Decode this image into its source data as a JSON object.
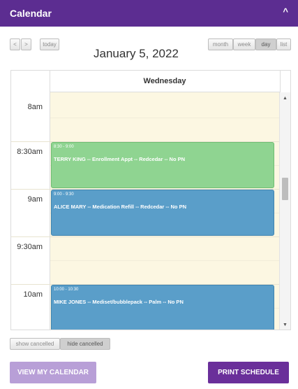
{
  "header": {
    "title": "Calendar",
    "collapse_icon": "chevron-up-icon"
  },
  "toolbar": {
    "prev_label": "<",
    "next_label": ">",
    "today_label": "today",
    "views": [
      "month",
      "week",
      "day",
      "list"
    ],
    "active_view": "day"
  },
  "calendar": {
    "title": "January 5, 2022",
    "day_header": "Wednesday",
    "time_labels": [
      "8am",
      "8:30am",
      "9am",
      "9:30am",
      "10am"
    ],
    "events": [
      {
        "time": "8:30 - 9:00",
        "title": "TERRY KING -- Enrollment Appt -- Redcedar -- No PN",
        "color": "#8fd491"
      },
      {
        "time": "9:00 - 9:30",
        "title": "ALICE MARY -- Medication Refill -- Redcedar -- No PN",
        "color": "#5a9ec9"
      },
      {
        "time": "10:00 - 10:30",
        "title": "MIKE JONES -- Mediset/bubblepack -- Palm -- No PN",
        "color": "#5a9ec9"
      }
    ]
  },
  "filters": {
    "show_cancelled": "show cancelled",
    "hide_cancelled": "hide cancelled"
  },
  "footer": {
    "view_calendar": "VIEW MY CALENDAR",
    "print_schedule": "PRINT SCHEDULE"
  },
  "colors": {
    "brand": "#5c2d91",
    "background_slot": "#fcf7e2"
  }
}
